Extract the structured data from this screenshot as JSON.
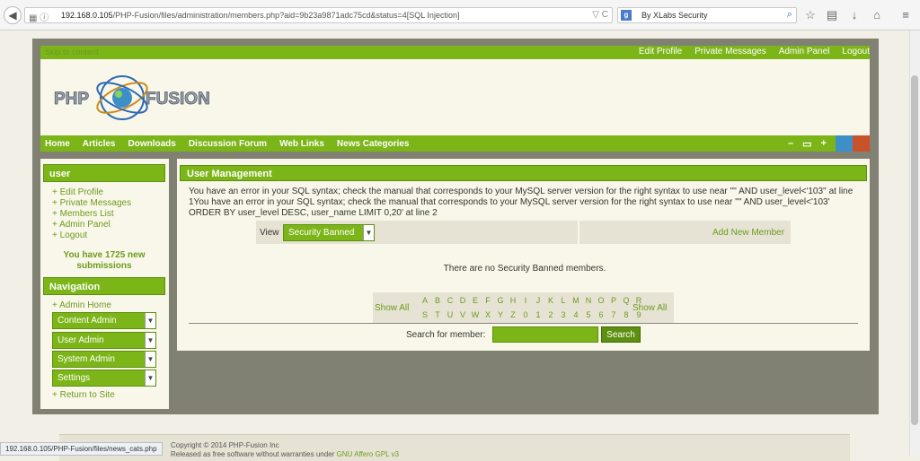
{
  "browser": {
    "url_host": "192.168.0.105",
    "url_path": "/PHP-Fusion/files/administration/members.php?aid=9b23a9871adc75cd&status=4[SQL Injection]",
    "search_engine_label": "By XLabs Security"
  },
  "top": {
    "skip": "Skip to content",
    "links": [
      "Edit Profile",
      "Private Messages",
      "Admin Panel",
      "Logout"
    ]
  },
  "logo_text": "PHP-FUSION",
  "nav": {
    "links": [
      "Home",
      "Articles",
      "Downloads",
      "Discussion Forum",
      "Web Links",
      "News Categories"
    ],
    "controls": [
      "–",
      "▭",
      "+"
    ],
    "swatches": [
      "#3d8fc8",
      "#c9522a"
    ]
  },
  "sidebar": {
    "user_title": "user",
    "user_links": [
      "Edit Profile",
      "Private Messages",
      "Members List",
      "Admin Panel",
      "Logout"
    ],
    "notice": "You have 1725 new submissions",
    "nav_title": "Navigation",
    "admin_home": "Admin Home",
    "admin_menus": [
      "Content Admin",
      "User Admin",
      "System Admin",
      "Settings"
    ],
    "return": "Return to Site"
  },
  "main": {
    "title": "User Management",
    "error": "You have an error in your SQL syntax; check the manual that corresponds to your MySQL server version for the right syntax to use near '\"' AND user_level<'103'' at line 1You have an error in your SQL syntax; check the manual that corresponds to your MySQL server version for the right syntax to use near '\"' AND user_level<'103' ORDER BY user_level DESC, user_name LIMIT 0,20' at line 2",
    "view_label": "View",
    "view_value": "Security Banned",
    "add_member": "Add New Member",
    "no_members": "There are no Security Banned members.",
    "show_all": "Show All",
    "letters_row1": [
      "A",
      "B",
      "C",
      "D",
      "E",
      "F",
      "G",
      "H",
      "I",
      "J",
      "K",
      "L",
      "M",
      "N",
      "O",
      "P",
      "Q",
      "R"
    ],
    "letters_row2": [
      "S",
      "T",
      "U",
      "V",
      "W",
      "X",
      "Y",
      "Z",
      "0",
      "1",
      "2",
      "3",
      "4",
      "5",
      "6",
      "7",
      "8",
      "9"
    ],
    "search_label": "Search for member:",
    "search_button": "Search"
  },
  "footer": {
    "line1": "Copyright © 2014 PHP-Fusion Inc",
    "line2_pre": "Released as free software without warranties under ",
    "line2_link": "GNU Affero GPL v3"
  },
  "status_url": "192.168.0.105/PHP-Fusion/files/news_cats.php"
}
